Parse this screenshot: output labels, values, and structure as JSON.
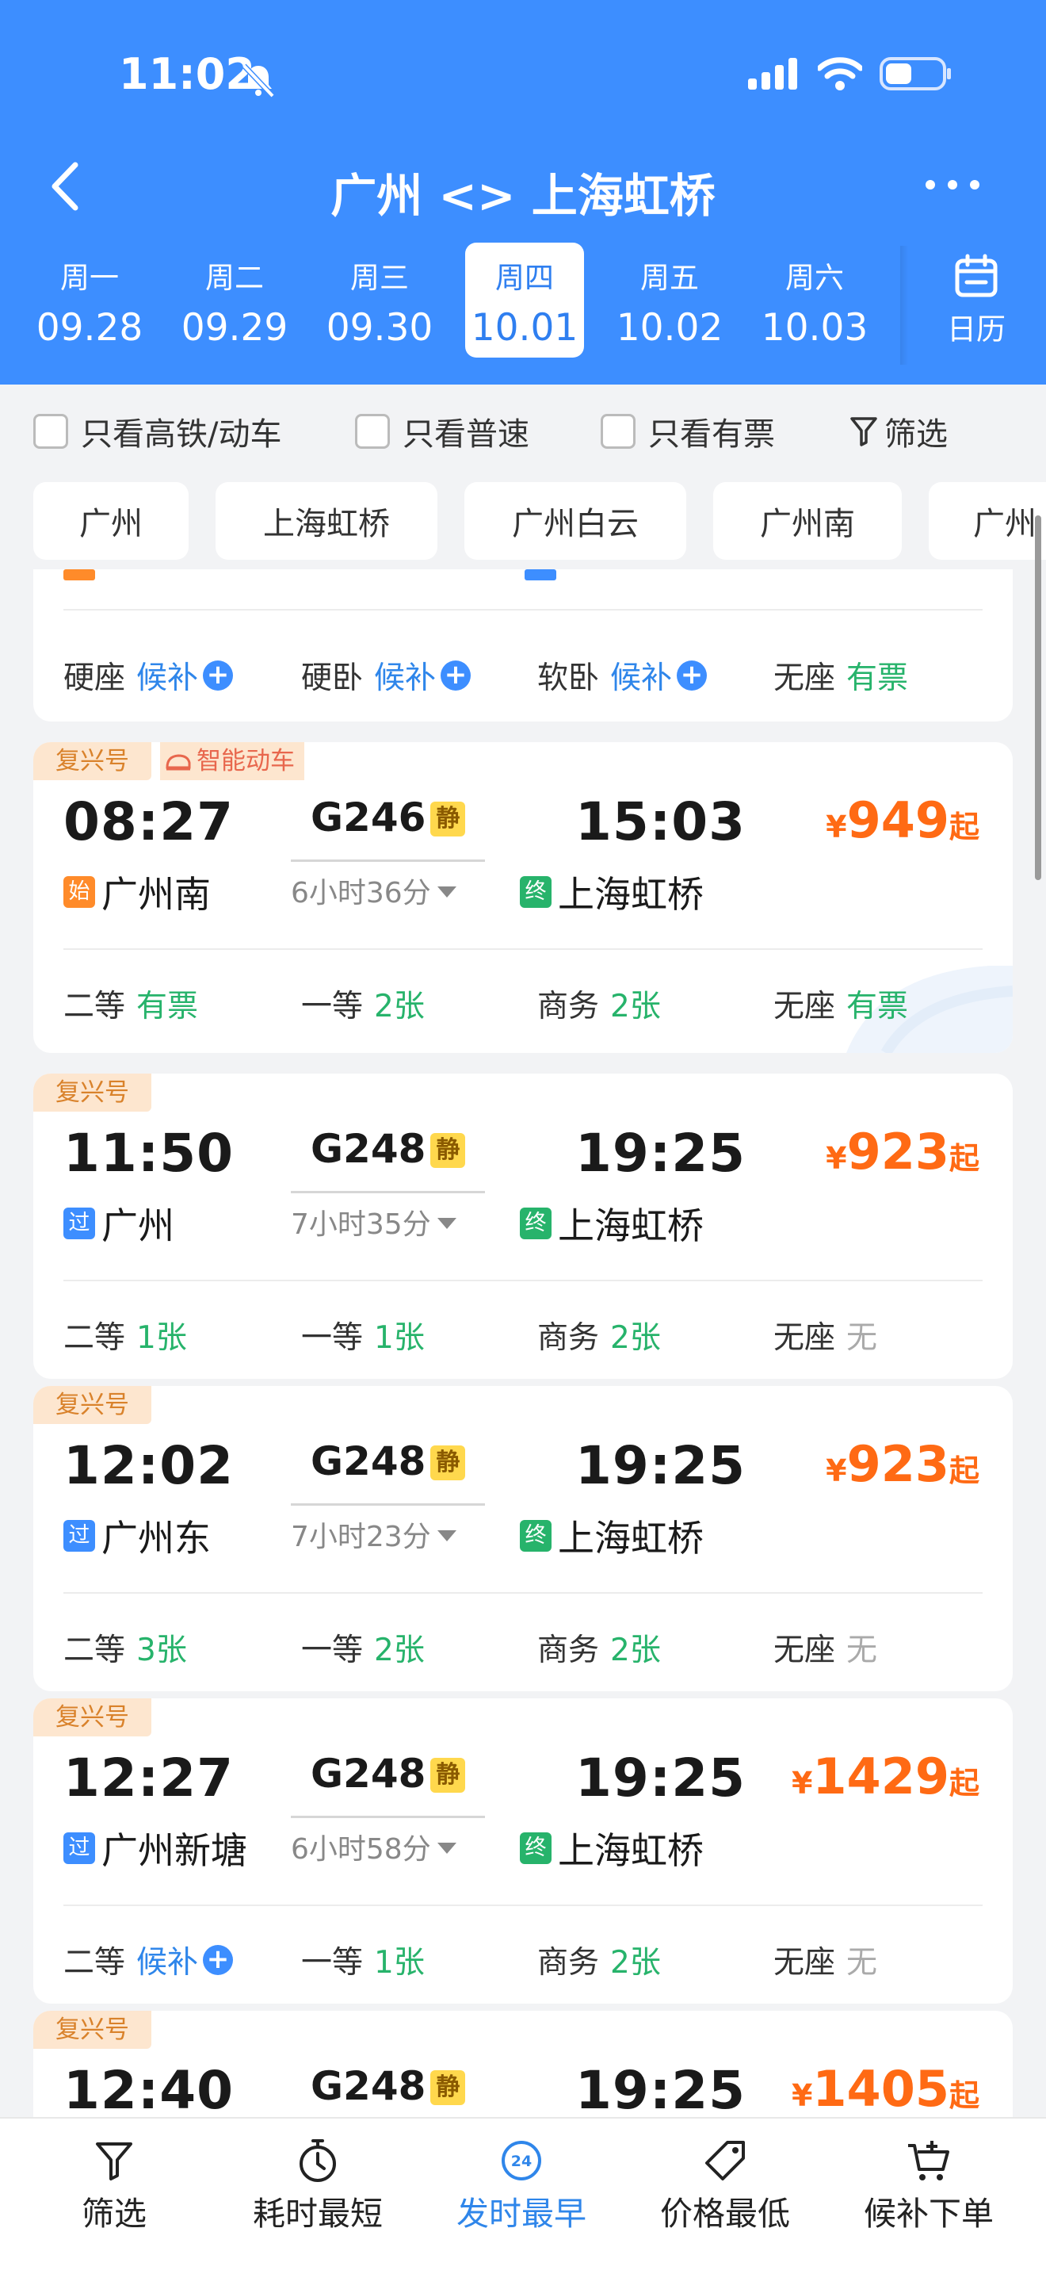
{
  "status_bar": {
    "time": "11:02"
  },
  "nav": {
    "title": "广州 <> 上海虹桥"
  },
  "dates": [
    {
      "weekday": "周一",
      "date": "09.28"
    },
    {
      "weekday": "周二",
      "date": "09.29"
    },
    {
      "weekday": "周三",
      "date": "09.30"
    },
    {
      "weekday": "周四",
      "date": "10.01",
      "selected": true
    },
    {
      "weekday": "周五",
      "date": "10.02"
    },
    {
      "weekday": "周六",
      "date": "10.03"
    }
  ],
  "calendar_label": "日历",
  "filters": {
    "high_speed": "只看高铁/动车",
    "normal": "只看普速",
    "available": "只看有票",
    "screen": "筛选"
  },
  "station_chips": [
    "广州",
    "上海虹桥",
    "广州白云",
    "广州南",
    "广州"
  ],
  "partial_card": {
    "seats": [
      {
        "class": "硬座",
        "status": "候补",
        "waitlist": true
      },
      {
        "class": "硬卧",
        "status": "候补",
        "waitlist": true
      },
      {
        "class": "软卧",
        "status": "候补",
        "waitlist": true
      },
      {
        "class": "无座",
        "status": "有票"
      }
    ]
  },
  "trains": [
    {
      "tag": "复兴号",
      "tag2": "智能动车",
      "depart_time": "08:27",
      "train_no": "G246",
      "quiet": "静",
      "arrive_time": "15:03",
      "duration": "6小时36分",
      "from_badge": "始",
      "from": "广州南",
      "to_badge": "终",
      "to": "上海虹桥",
      "price": "949",
      "currency": "¥",
      "price_suffix": "起",
      "seats": [
        {
          "class": "二等",
          "status": "有票"
        },
        {
          "class": "一等",
          "status": "2张"
        },
        {
          "class": "商务",
          "status": "2张"
        },
        {
          "class": "无座",
          "status": "有票"
        }
      ]
    },
    {
      "tag": "复兴号",
      "depart_time": "11:50",
      "train_no": "G248",
      "quiet": "静",
      "arrive_time": "19:25",
      "duration": "7小时35分",
      "from_badge": "过",
      "from": "广州",
      "to_badge": "终",
      "to": "上海虹桥",
      "price": "923",
      "currency": "¥",
      "price_suffix": "起",
      "seats": [
        {
          "class": "二等",
          "status": "1张"
        },
        {
          "class": "一等",
          "status": "1张"
        },
        {
          "class": "商务",
          "status": "2张"
        },
        {
          "class": "无座",
          "status": "无"
        }
      ]
    },
    {
      "tag": "复兴号",
      "depart_time": "12:02",
      "train_no": "G248",
      "quiet": "静",
      "arrive_time": "19:25",
      "duration": "7小时23分",
      "from_badge": "过",
      "from": "广州东",
      "to_badge": "终",
      "to": "上海虹桥",
      "price": "923",
      "currency": "¥",
      "price_suffix": "起",
      "seats": [
        {
          "class": "二等",
          "status": "3张"
        },
        {
          "class": "一等",
          "status": "2张"
        },
        {
          "class": "商务",
          "status": "2张"
        },
        {
          "class": "无座",
          "status": "无"
        }
      ]
    },
    {
      "tag": "复兴号",
      "depart_time": "12:27",
      "train_no": "G248",
      "quiet": "静",
      "arrive_time": "19:25",
      "duration": "6小时58分",
      "from_badge": "过",
      "from": "广州新塘",
      "to_badge": "终",
      "to": "上海虹桥",
      "price": "1429",
      "currency": "¥",
      "price_suffix": "起",
      "seats": [
        {
          "class": "二等",
          "status": "候补",
          "waitlist": true
        },
        {
          "class": "一等",
          "status": "1张"
        },
        {
          "class": "商务",
          "status": "2张"
        },
        {
          "class": "无座",
          "status": "无"
        }
      ]
    },
    {
      "tag": "复兴号",
      "depart_time": "12:40",
      "train_no": "G248",
      "quiet": "静",
      "arrive_time": "19:25",
      "price": "1405",
      "currency": "¥",
      "price_suffix": "起"
    }
  ],
  "tabbar": [
    {
      "label": "筛选",
      "icon": "filter-icon"
    },
    {
      "label": "耗时最短",
      "icon": "stopwatch-icon"
    },
    {
      "label": "发时最早",
      "icon": "clock-24-icon",
      "active": true
    },
    {
      "label": "价格最低",
      "icon": "price-tag-icon"
    },
    {
      "label": "候补下单",
      "icon": "cart-plus-icon"
    }
  ],
  "colors": {
    "brand_blue": "#3d8eff",
    "price_orange": "#ff6a14",
    "available_green": "#27b36b",
    "waitlist_blue": "#2f86ea",
    "tag_bg": "#fde6cf"
  }
}
